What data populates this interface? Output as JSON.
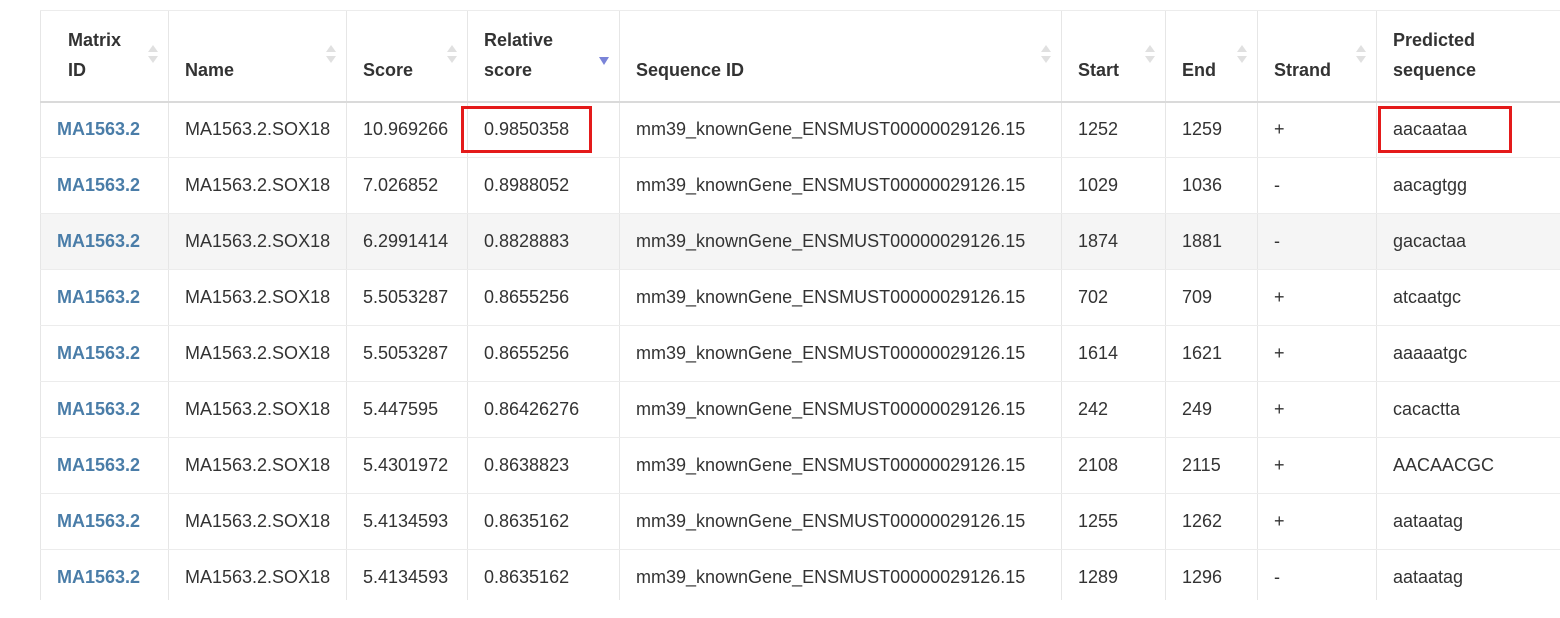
{
  "table": {
    "headers": [
      {
        "label_line1": "Matrix",
        "label_line2": "ID",
        "sort": "none"
      },
      {
        "label_line1": "",
        "label_line2": "Name",
        "sort": "none"
      },
      {
        "label_line1": "",
        "label_line2": "Score",
        "sort": "none"
      },
      {
        "label_line1": "Relative",
        "label_line2": "score",
        "sort": "desc"
      },
      {
        "label_line1": "",
        "label_line2": "Sequence ID",
        "sort": "none"
      },
      {
        "label_line1": "",
        "label_line2": "Start",
        "sort": "none"
      },
      {
        "label_line1": "",
        "label_line2": "End",
        "sort": "none"
      },
      {
        "label_line1": "",
        "label_line2": "Strand",
        "sort": "none"
      },
      {
        "label_line1": "Predicted",
        "label_line2": "sequence",
        "sort": "none"
      }
    ],
    "rows": [
      {
        "matrix_id": "MA1563.2",
        "name": "MA1563.2.SOX18",
        "score": "10.969266",
        "relative_score": "0.9850358",
        "sequence_id": "mm39_knownGene_ENSMUST00000029126.15",
        "start": "1252",
        "end": "1259",
        "strand": "+",
        "predicted_sequence": "aacaataa"
      },
      {
        "matrix_id": "MA1563.2",
        "name": "MA1563.2.SOX18",
        "score": "7.026852",
        "relative_score": "0.8988052",
        "sequence_id": "mm39_knownGene_ENSMUST00000029126.15",
        "start": "1029",
        "end": "1036",
        "strand": "-",
        "predicted_sequence": "aacagtgg"
      },
      {
        "matrix_id": "MA1563.2",
        "name": "MA1563.2.SOX18",
        "score": "6.2991414",
        "relative_score": "0.8828883",
        "sequence_id": "mm39_knownGene_ENSMUST00000029126.15",
        "start": "1874",
        "end": "1881",
        "strand": "-",
        "predicted_sequence": "gacactaa"
      },
      {
        "matrix_id": "MA1563.2",
        "name": "MA1563.2.SOX18",
        "score": "5.5053287",
        "relative_score": "0.8655256",
        "sequence_id": "mm39_knownGene_ENSMUST00000029126.15",
        "start": "702",
        "end": "709",
        "strand": "+",
        "predicted_sequence": "atcaatgc"
      },
      {
        "matrix_id": "MA1563.2",
        "name": "MA1563.2.SOX18",
        "score": "5.5053287",
        "relative_score": "0.8655256",
        "sequence_id": "mm39_knownGene_ENSMUST00000029126.15",
        "start": "1614",
        "end": "1621",
        "strand": "+",
        "predicted_sequence": "aaaaatgc"
      },
      {
        "matrix_id": "MA1563.2",
        "name": "MA1563.2.SOX18",
        "score": "5.447595",
        "relative_score": "0.86426276",
        "sequence_id": "mm39_knownGene_ENSMUST00000029126.15",
        "start": "242",
        "end": "249",
        "strand": "+",
        "predicted_sequence": "cacactta"
      },
      {
        "matrix_id": "MA1563.2",
        "name": "MA1563.2.SOX18",
        "score": "5.4301972",
        "relative_score": "0.8638823",
        "sequence_id": "mm39_knownGene_ENSMUST00000029126.15",
        "start": "2108",
        "end": "2115",
        "strand": "+",
        "predicted_sequence": "AACAACGC"
      },
      {
        "matrix_id": "MA1563.2",
        "name": "MA1563.2.SOX18",
        "score": "5.4134593",
        "relative_score": "0.8635162",
        "sequence_id": "mm39_knownGene_ENSMUST00000029126.15",
        "start": "1255",
        "end": "1262",
        "strand": "+",
        "predicted_sequence": "aataatag"
      },
      {
        "matrix_id": "MA1563.2",
        "name": "MA1563.2.SOX18",
        "score": "5.4134593",
        "relative_score": "0.8635162",
        "sequence_id": "mm39_knownGene_ENSMUST00000029126.15",
        "start": "1289",
        "end": "1296",
        "strand": "-",
        "predicted_sequence": "aataatag"
      }
    ]
  },
  "colors": {
    "link": "#4a7da8",
    "highlight_box": "#e41a1a",
    "sort_active": "#7a84d8",
    "stripe": "#f5f5f5"
  }
}
